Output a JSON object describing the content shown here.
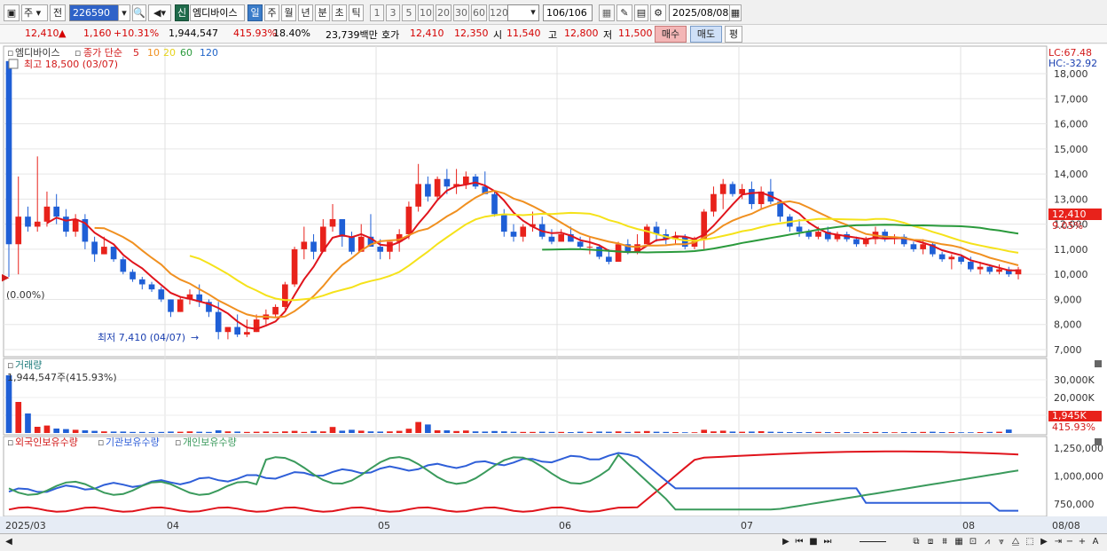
{
  "toolbar": {
    "market": "주",
    "period_prefix": "전",
    "code": "226590",
    "info_badge": "신",
    "stock_name": "엠디바이스",
    "periods": [
      "일",
      "주",
      "월",
      "년",
      "분",
      "초",
      "틱"
    ],
    "active_period": "일",
    "intervals": [
      "1",
      "3",
      "5",
      "10",
      "20",
      "30",
      "60",
      "120"
    ],
    "count": "106",
    "count_total": "/106",
    "date": "2025/08/08"
  },
  "infobar": {
    "price": "12,410",
    "change": "1,160",
    "change_pct": "+10.31%",
    "volume": "1,944,547",
    "volume_ratio": "415.93%",
    "turnover": "18.40%",
    "amount": "23,739백만",
    "ask_label": "호가",
    "ask": "12,410",
    "bid": "12,350",
    "open_label": "시",
    "open": "11,540",
    "high_label": "고",
    "high": "12,800",
    "low_label": "저",
    "low": "11,500",
    "buy_label": "매수",
    "sell_label": "매도",
    "eval_label": "평"
  },
  "price_panel": {
    "legend_name": "엠디바이스",
    "legend_ma_label": "종가 단순",
    "ma_periods": [
      "5",
      "10",
      "20",
      "60",
      "120"
    ],
    "max_label": "최고 18,500 (03/07)",
    "min_label": "최저 7,410 (04/07)",
    "base_label": "(0.00%)",
    "lc_label": "LC:67.48",
    "hc_label": "HC:-32.92",
    "last_price_tag": "12,410",
    "last_pct_tag": "9.05%",
    "y_ticks": [
      "18,000",
      "17,000",
      "16,000",
      "15,000",
      "14,000",
      "13,000",
      "12,000",
      "11,000",
      "10,000",
      "9,000",
      "8,000",
      "7,000"
    ]
  },
  "volume_panel": {
    "title": "거래량",
    "info": "1,944,547주(415.93%)",
    "y_ticks": [
      "30,000K",
      "20,000K",
      "10,000K"
    ],
    "last_tag": "1,945K",
    "last_pct": "415.93%"
  },
  "holding_panel": {
    "legend": [
      "외국인보유수량",
      "기관보유수량",
      "개인보유수량"
    ],
    "y_ticks": [
      "1,250,000",
      "1,000,000",
      "750,000"
    ]
  },
  "x_axis": {
    "labels": [
      "2025/03",
      "04",
      "05",
      "06",
      "07",
      "08"
    ],
    "right_label": "08/08"
  },
  "colors": {
    "up": "#e8221b",
    "down": "#1f5fd6",
    "ma5": "#e0141c",
    "ma10": "#f09020",
    "ma20": "#f5e21a",
    "ma60": "#2a9a3c",
    "ma120": "#1f64c8",
    "foreign": "#e0141c",
    "institution": "#2f5fd8",
    "individual": "#3a9a5c"
  },
  "chart_data": {
    "type": "candlestick",
    "candles": [
      [
        18500,
        18500,
        9900,
        11200
      ],
      [
        11200,
        13900,
        10000,
        12300
      ],
      [
        12300,
        12700,
        11700,
        11900
      ],
      [
        11900,
        14700,
        11700,
        12100
      ],
      [
        12100,
        13300,
        11900,
        12700
      ],
      [
        12700,
        13200,
        12000,
        12300
      ],
      [
        12300,
        12600,
        11500,
        11700
      ],
      [
        11700,
        12400,
        11500,
        12200
      ],
      [
        12200,
        12400,
        11000,
        11300
      ],
      [
        11300,
        11500,
        10500,
        10800
      ],
      [
        10800,
        11500,
        10800,
        11100
      ],
      [
        11100,
        11100,
        10500,
        10600
      ],
      [
        10600,
        10700,
        10000,
        10100
      ],
      [
        10100,
        10200,
        9700,
        9800
      ],
      [
        9800,
        9900,
        9400,
        9600
      ],
      [
        9600,
        9700,
        9300,
        9400
      ],
      [
        9400,
        9500,
        8900,
        9000
      ],
      [
        9000,
        9000,
        8300,
        8500
      ],
      [
        8500,
        9100,
        8500,
        9000
      ],
      [
        9000,
        9400,
        8800,
        9200
      ],
      [
        9200,
        9600,
        8700,
        8900
      ],
      [
        8900,
        9000,
        8300,
        8500
      ],
      [
        8500,
        8900,
        7410,
        7700
      ],
      [
        7700,
        7900,
        7410,
        7900
      ],
      [
        7900,
        8400,
        7500,
        7600
      ],
      [
        7600,
        8200,
        7500,
        7700
      ],
      [
        7700,
        8400,
        7700,
        8200
      ],
      [
        8200,
        8600,
        8000,
        8400
      ],
      [
        8400,
        8800,
        8300,
        8700
      ],
      [
        8700,
        9700,
        8600,
        9600
      ],
      [
        9600,
        11100,
        9500,
        11000
      ],
      [
        11000,
        11900,
        10600,
        11300
      ],
      [
        11300,
        11600,
        10600,
        10900
      ],
      [
        10900,
        12200,
        10900,
        11900
      ],
      [
        11900,
        12800,
        11700,
        12200
      ],
      [
        12200,
        12200,
        11100,
        11500
      ],
      [
        11500,
        11700,
        10800,
        10900
      ],
      [
        10900,
        12000,
        10900,
        11500
      ],
      [
        11500,
        12400,
        11300,
        11100
      ],
      [
        11100,
        11400,
        10600,
        10900
      ],
      [
        10900,
        11300,
        10600,
        11300
      ],
      [
        11300,
        11800,
        10900,
        11600
      ],
      [
        11600,
        12900,
        11400,
        12700
      ],
      [
        12700,
        14400,
        12500,
        13600
      ],
      [
        13600,
        13900,
        12900,
        13100
      ],
      [
        13100,
        13900,
        13000,
        13800
      ],
      [
        13800,
        14200,
        13200,
        13500
      ],
      [
        13500,
        14200,
        13200,
        13600
      ],
      [
        13600,
        14100,
        13400,
        13900
      ],
      [
        13900,
        14000,
        13400,
        13500
      ],
      [
        13500,
        14100,
        13400,
        13200
      ],
      [
        13200,
        13300,
        12300,
        12400
      ],
      [
        12400,
        12600,
        11500,
        11700
      ],
      [
        11700,
        12000,
        11300,
        11500
      ],
      [
        11500,
        12000,
        11300,
        11900
      ],
      [
        11900,
        12500,
        11700,
        12000
      ],
      [
        12000,
        12300,
        11400,
        11500
      ],
      [
        11500,
        11800,
        11200,
        11300
      ],
      [
        11300,
        11800,
        11300,
        11600
      ],
      [
        11600,
        11900,
        11300,
        11300
      ],
      [
        11300,
        11500,
        11000,
        11100
      ],
      [
        11100,
        11500,
        10800,
        11100
      ],
      [
        11100,
        11200,
        10600,
        10700
      ],
      [
        10700,
        11000,
        10400,
        10500
      ],
      [
        10500,
        11300,
        10500,
        11200
      ],
      [
        11200,
        11400,
        10800,
        10900
      ],
      [
        10900,
        11600,
        10800,
        11200
      ],
      [
        11200,
        12000,
        11200,
        11900
      ],
      [
        11900,
        12100,
        11300,
        11600
      ],
      [
        11600,
        11800,
        11200,
        11400
      ],
      [
        11400,
        11700,
        11200,
        11500
      ],
      [
        11500,
        11600,
        11000,
        11100
      ],
      [
        11100,
        11500,
        11000,
        11400
      ],
      [
        11400,
        12600,
        11000,
        12500
      ],
      [
        12500,
        13500,
        12300,
        13200
      ],
      [
        13200,
        13800,
        12600,
        13600
      ],
      [
        13600,
        13700,
        13100,
        13200
      ],
      [
        13200,
        13600,
        13000,
        13400
      ],
      [
        13400,
        13700,
        12600,
        12800
      ],
      [
        12800,
        13500,
        12600,
        13300
      ],
      [
        13300,
        13800,
        12800,
        12900
      ],
      [
        12900,
        12900,
        12100,
        12300
      ],
      [
        12300,
        12400,
        11700,
        11900
      ],
      [
        11900,
        12200,
        11500,
        11700
      ],
      [
        11700,
        11800,
        11400,
        11500
      ],
      [
        11500,
        11900,
        11400,
        11700
      ],
      [
        11700,
        11900,
        11300,
        11400
      ],
      [
        11400,
        11700,
        11300,
        11600
      ],
      [
        11600,
        11700,
        11300,
        11400
      ],
      [
        11400,
        11500,
        11100,
        11200
      ],
      [
        11200,
        11500,
        11100,
        11400
      ],
      [
        11400,
        11900,
        11200,
        11700
      ],
      [
        11700,
        11800,
        11300,
        11400
      ],
      [
        11400,
        11600,
        11200,
        11500
      ],
      [
        11500,
        11600,
        11100,
        11200
      ],
      [
        11200,
        11300,
        10900,
        11000
      ],
      [
        11000,
        11400,
        10800,
        11200
      ],
      [
        11200,
        11300,
        10700,
        10800
      ],
      [
        10800,
        10900,
        10500,
        10600
      ],
      [
        10600,
        10800,
        10200,
        10700
      ],
      [
        10700,
        10800,
        10400,
        10500
      ],
      [
        10500,
        10700,
        10100,
        10200
      ],
      [
        10200,
        10500,
        10000,
        10300
      ],
      [
        10300,
        10400,
        10000,
        10100
      ],
      [
        10100,
        10400,
        10000,
        10200
      ],
      [
        10200,
        10300,
        9900,
        10000
      ],
      [
        10000,
        10300,
        9800,
        10200
      ]
    ],
    "volume_k": [
      32500,
      17500,
      11000,
      3500,
      4200,
      2500,
      2200,
      1800,
      1500,
      1200,
      900,
      800,
      800,
      600,
      600,
      500,
      600,
      800,
      700,
      900,
      700,
      600,
      1500,
      900,
      800,
      600,
      700,
      800,
      600,
      900,
      1200,
      600,
      1100,
      900,
      3400,
      1300,
      1800,
      1300,
      900,
      800,
      900,
      1200,
      2400,
      6200,
      4800,
      1500,
      1500,
      1100,
      1400,
      900,
      800,
      1100,
      900,
      700,
      600,
      600,
      700,
      600,
      600,
      500,
      700,
      600,
      800,
      700,
      900,
      600,
      800,
      1100,
      700,
      600,
      500,
      400,
      400,
      1800,
      900,
      1300,
      800,
      700,
      800,
      1000,
      700,
      600,
      500,
      500,
      500,
      600,
      500,
      500,
      500,
      400,
      500,
      600,
      500,
      400,
      500,
      500,
      600,
      700,
      500,
      500,
      400,
      400,
      500,
      600,
      700,
      1945
    ],
    "ma_levels": {
      "ma60_start": 10800,
      "ma60_end": 11400
    }
  }
}
